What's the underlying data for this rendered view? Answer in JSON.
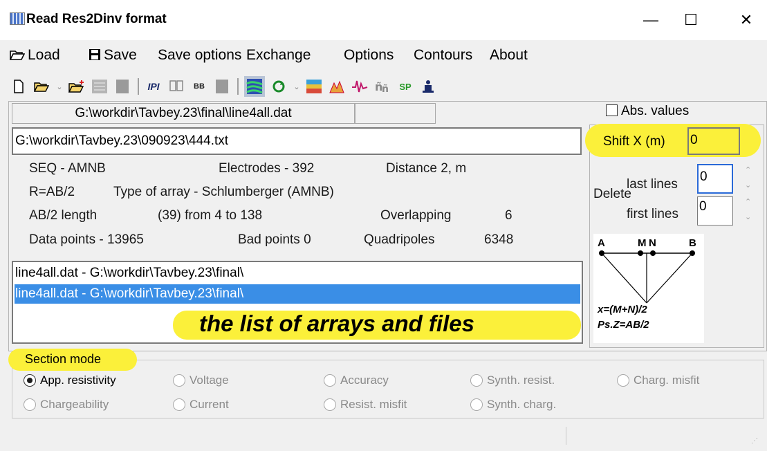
{
  "window": {
    "title": "Read Res2Dinv format",
    "minimize": "—",
    "maximize": "☐",
    "close": "✕"
  },
  "menu": {
    "load": "Load",
    "save": "Save",
    "save_options": "Save options",
    "exchange": "Exchange",
    "options": "Options",
    "contours": "Contours",
    "about": "About"
  },
  "toolbar": {
    "labels": {
      "ipi": "IPI",
      "bb": "BB",
      "sp": "SP"
    }
  },
  "header": {
    "path": "G:\\workdir\\Tavbey.23\\final\\line4all.dat",
    "path2": "",
    "abs_values_label": "Abs. values"
  },
  "file_input": {
    "value": "G:\\workdir\\Tavbey.23\\090923\\444.txt"
  },
  "shift": {
    "label": "Shift X (m)",
    "value": "0"
  },
  "delete": {
    "label": "Delete",
    "last_lines_label": "last lines",
    "last_lines_value": "0",
    "first_lines_label": "first lines",
    "first_lines_value": "0"
  },
  "info": {
    "seq": "SEQ -   AMNB",
    "electrodes": "Electrodes -   392",
    "distance": "Distance   2, m",
    "r": "R=AB/2",
    "type_of_array": "Type of array  - Schlumberger (AMNB)",
    "ab2_length": "AB/2 length",
    "ab2_range": "(39) from 4 to 138",
    "overlapping_label": "Overlapping",
    "overlapping_value": "6",
    "data_points": "Data points - 13965",
    "bad_points": "Bad points  0",
    "quadripoles_label": "Quadripoles",
    "quadripoles_value": "6348"
  },
  "list": {
    "items": [
      "line4all.dat - G:\\workdir\\Tavbey.23\\final\\",
      "line4all.dat - G:\\workdir\\Tavbey.23\\final\\"
    ],
    "selected_index": 1,
    "caption": "the list of arrays and files"
  },
  "diagram": {
    "a": "A",
    "m": "M",
    "n": "N",
    "b": "B",
    "formula_x": "x=(M+N)/2",
    "formula_z": "Ps.Z=AB/2"
  },
  "section_mode": {
    "title": "Section mode",
    "options": [
      "App. resistivity",
      "Voltage",
      "Accuracy",
      "Synth. resist.",
      "Charg. misfit",
      "Chargeability",
      "Current",
      "Resist. misfit",
      "Synth. charg."
    ],
    "selected": "App. resistivity"
  },
  "colors": {
    "highlight": "#fbf03a",
    "selection": "#3a8ee6",
    "window_bg": "#f0f0f0"
  }
}
